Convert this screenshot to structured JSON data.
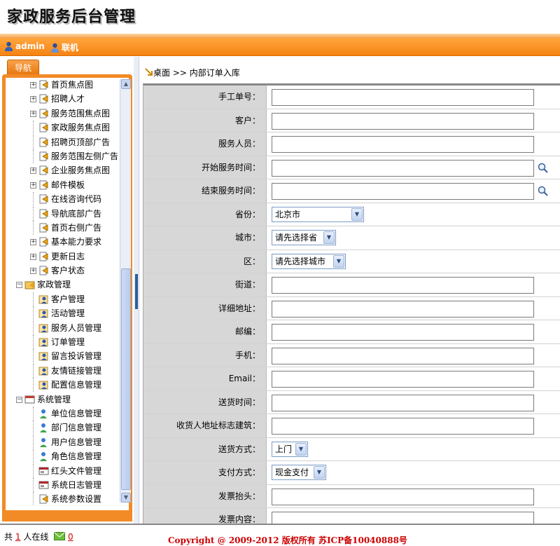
{
  "header": {
    "title": "家政服务后台管理"
  },
  "userbar": {
    "username": "admin",
    "status": "联机"
  },
  "sidebar": {
    "tab_label": "导航",
    "tree": [
      {
        "label": "首页焦点图",
        "level": 1,
        "expander": "+"
      },
      {
        "label": "招聘人才",
        "level": 1,
        "expander": "+"
      },
      {
        "label": "服务范围焦点图",
        "level": 1,
        "expander": "+"
      },
      {
        "label": "家政服务焦点图",
        "level": 1,
        "expander": ""
      },
      {
        "label": "招聘页顶部广告",
        "level": 1,
        "expander": ""
      },
      {
        "label": "服务范围左侧广告",
        "level": 1,
        "expander": ""
      },
      {
        "label": "企业服务焦点图",
        "level": 1,
        "expander": "+"
      },
      {
        "label": "邮件模板",
        "level": 1,
        "expander": "+"
      },
      {
        "label": "在线咨询代码",
        "level": 1,
        "expander": ""
      },
      {
        "label": "导航底部广告",
        "level": 1,
        "expander": ""
      },
      {
        "label": "首页右侧广告",
        "level": 1,
        "expander": ""
      },
      {
        "label": "基本能力要求",
        "level": 1,
        "expander": "+"
      },
      {
        "label": "更新日志",
        "level": 1,
        "expander": "+"
      },
      {
        "label": "客户状态",
        "level": 1,
        "expander": "+"
      },
      {
        "label": "家政管理",
        "level": 0,
        "expander": "−"
      },
      {
        "label": "客户管理",
        "level": 1,
        "expander": ""
      },
      {
        "label": "活动管理",
        "level": 1,
        "expander": ""
      },
      {
        "label": "服务人员管理",
        "level": 1,
        "expander": ""
      },
      {
        "label": "订单管理",
        "level": 1,
        "expander": ""
      },
      {
        "label": "留言投诉管理",
        "level": 1,
        "expander": ""
      },
      {
        "label": "友情链接管理",
        "level": 1,
        "expander": ""
      },
      {
        "label": "配置信息管理",
        "level": 1,
        "expander": ""
      },
      {
        "label": "系统管理",
        "level": 0,
        "expander": "−"
      },
      {
        "label": "单位信息管理",
        "level": 1,
        "expander": ""
      },
      {
        "label": "部门信息管理",
        "level": 1,
        "expander": ""
      },
      {
        "label": "用户信息管理",
        "level": 1,
        "expander": ""
      },
      {
        "label": "角色信息管理",
        "level": 1,
        "expander": ""
      },
      {
        "label": "红头文件管理",
        "level": 1,
        "expander": ""
      },
      {
        "label": "系统日志管理",
        "level": 1,
        "expander": ""
      },
      {
        "label": "系统参数设置",
        "level": 1,
        "expander": ""
      }
    ]
  },
  "breadcrumb": "桌面 >> 内部订单入库",
  "form": {
    "rows": [
      {
        "label": "手工单号：",
        "type": "text",
        "value": ""
      },
      {
        "label": "客户：",
        "type": "text",
        "value": ""
      },
      {
        "label": "服务人员：",
        "type": "text",
        "value": ""
      },
      {
        "label": "开始服务时间：",
        "type": "date",
        "value": ""
      },
      {
        "label": "结束服务时间：",
        "type": "date",
        "value": ""
      },
      {
        "label": "省份：",
        "type": "select",
        "value": "北京市"
      },
      {
        "label": "城市：",
        "type": "select",
        "value": "请先选择省"
      },
      {
        "label": "区：",
        "type": "select",
        "value": "请先选择城市"
      },
      {
        "label": "街道：",
        "type": "text",
        "value": ""
      },
      {
        "label": "详细地址：",
        "type": "text",
        "value": ""
      },
      {
        "label": "邮编：",
        "type": "text",
        "value": ""
      },
      {
        "label": "手机：",
        "type": "text",
        "value": ""
      },
      {
        "label": "Email：",
        "type": "text",
        "value": ""
      },
      {
        "label": "送货时间：",
        "type": "text",
        "value": ""
      },
      {
        "label": "收货人地址标志建筑：",
        "type": "text",
        "value": ""
      },
      {
        "label": "送货方式：",
        "type": "select",
        "value": "上门"
      },
      {
        "label": "支付方式：",
        "type": "select",
        "value": "现金支付"
      },
      {
        "label": "发票抬头：",
        "type": "text",
        "value": ""
      },
      {
        "label": "发票内容：",
        "type": "text",
        "value": ""
      }
    ]
  },
  "footer": {
    "online_prefix": "共",
    "online_count": "1",
    "online_suffix": "人在线",
    "message_count": "0",
    "copyright": "Copyright @ 2009-2012 版权所有  苏ICP备10040888号"
  },
  "colors": {
    "accent": "#f58312",
    "label_bg": "#d7d7d7",
    "copyright": "#cc0000"
  }
}
